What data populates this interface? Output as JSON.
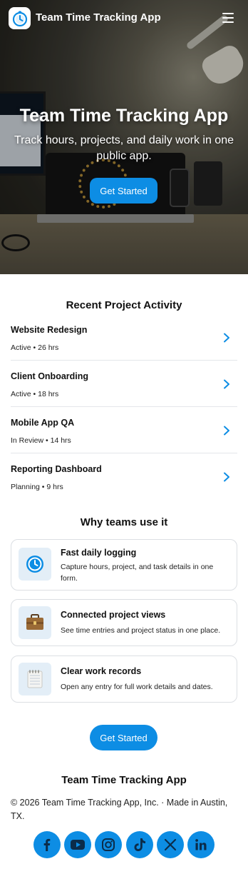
{
  "header": {
    "app_title": "Team Time Tracking App",
    "logo_icon": "stopwatch-icon",
    "menu_icon": "hamburger-menu-icon"
  },
  "hero": {
    "title": "Team Time Tracking App",
    "subtitle": "Track hours, projects, and daily work in one public app.",
    "cta_label": "Get Started"
  },
  "activity": {
    "title": "Recent Project Activity",
    "items": [
      {
        "name": "Website Redesign",
        "meta": "Active • 26 hrs"
      },
      {
        "name": "Client Onboarding",
        "meta": "Active • 18 hrs"
      },
      {
        "name": "Mobile App QA",
        "meta": "In Review • 14 hrs"
      },
      {
        "name": "Reporting Dashboard",
        "meta": "Planning • 9 hrs"
      }
    ]
  },
  "features": {
    "title": "Why teams use it",
    "items": [
      {
        "icon": "clock-icon",
        "title": "Fast daily logging",
        "desc": "Capture hours, project, and task details in one form."
      },
      {
        "icon": "briefcase-icon",
        "title": "Connected project views",
        "desc": "See time entries and project status in one place."
      },
      {
        "icon": "notepad-icon",
        "title": "Clear work records",
        "desc": "Open any entry for full work details and dates."
      }
    ]
  },
  "cta": {
    "label": "Get Started"
  },
  "footer": {
    "title": "Team Time Tracking App",
    "copyright": "© 2026 Team Time Tracking App, Inc. · Made in Austin, TX.",
    "socials": [
      "facebook-icon",
      "youtube-icon",
      "instagram-icon",
      "tiktok-icon",
      "x-icon",
      "linkedin-icon"
    ]
  },
  "colors": {
    "accent": "#0d8de4",
    "text": "#111111",
    "divider": "#e4e6ea",
    "icon_bg": "#e3eef7"
  }
}
